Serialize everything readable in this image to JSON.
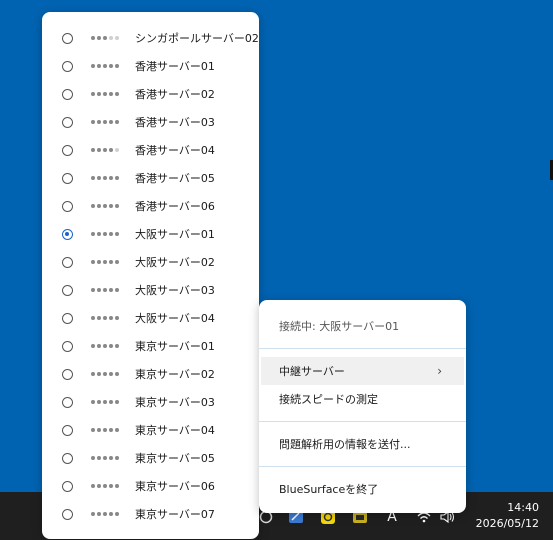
{
  "server_menu": {
    "items": [
      {
        "label": "シンガポールサーバー02",
        "signal": 3,
        "selected": false
      },
      {
        "label": "香港サーバー01",
        "signal": 5,
        "selected": false
      },
      {
        "label": "香港サーバー02",
        "signal": 5,
        "selected": false
      },
      {
        "label": "香港サーバー03",
        "signal": 5,
        "selected": false
      },
      {
        "label": "香港サーバー04",
        "signal": 4,
        "selected": false
      },
      {
        "label": "香港サーバー05",
        "signal": 5,
        "selected": false
      },
      {
        "label": "香港サーバー06",
        "signal": 5,
        "selected": false
      },
      {
        "label": "大阪サーバー01",
        "signal": 5,
        "selected": true
      },
      {
        "label": "大阪サーバー02",
        "signal": 5,
        "selected": false
      },
      {
        "label": "大阪サーバー03",
        "signal": 5,
        "selected": false
      },
      {
        "label": "大阪サーバー04",
        "signal": 5,
        "selected": false
      },
      {
        "label": "東京サーバー01",
        "signal": 5,
        "selected": false
      },
      {
        "label": "東京サーバー02",
        "signal": 5,
        "selected": false
      },
      {
        "label": "東京サーバー03",
        "signal": 5,
        "selected": false
      },
      {
        "label": "東京サーバー04",
        "signal": 5,
        "selected": false
      },
      {
        "label": "東京サーバー05",
        "signal": 5,
        "selected": false
      },
      {
        "label": "東京サーバー06",
        "signal": 5,
        "selected": false
      },
      {
        "label": "東京サーバー07",
        "signal": 5,
        "selected": false
      }
    ]
  },
  "context_menu": {
    "status": "接続中: 大阪サーバー01",
    "relay_server": "中継サーバー",
    "relay_chevron": "›",
    "speed_test": "接続スピードの測定",
    "send_diagnostics": "問題解析用の情報を送付...",
    "quit": "BlueSurfaceを終了"
  },
  "taskbar": {
    "time": "14:40",
    "date": "2026/05/12",
    "ime_indicator": "A"
  }
}
